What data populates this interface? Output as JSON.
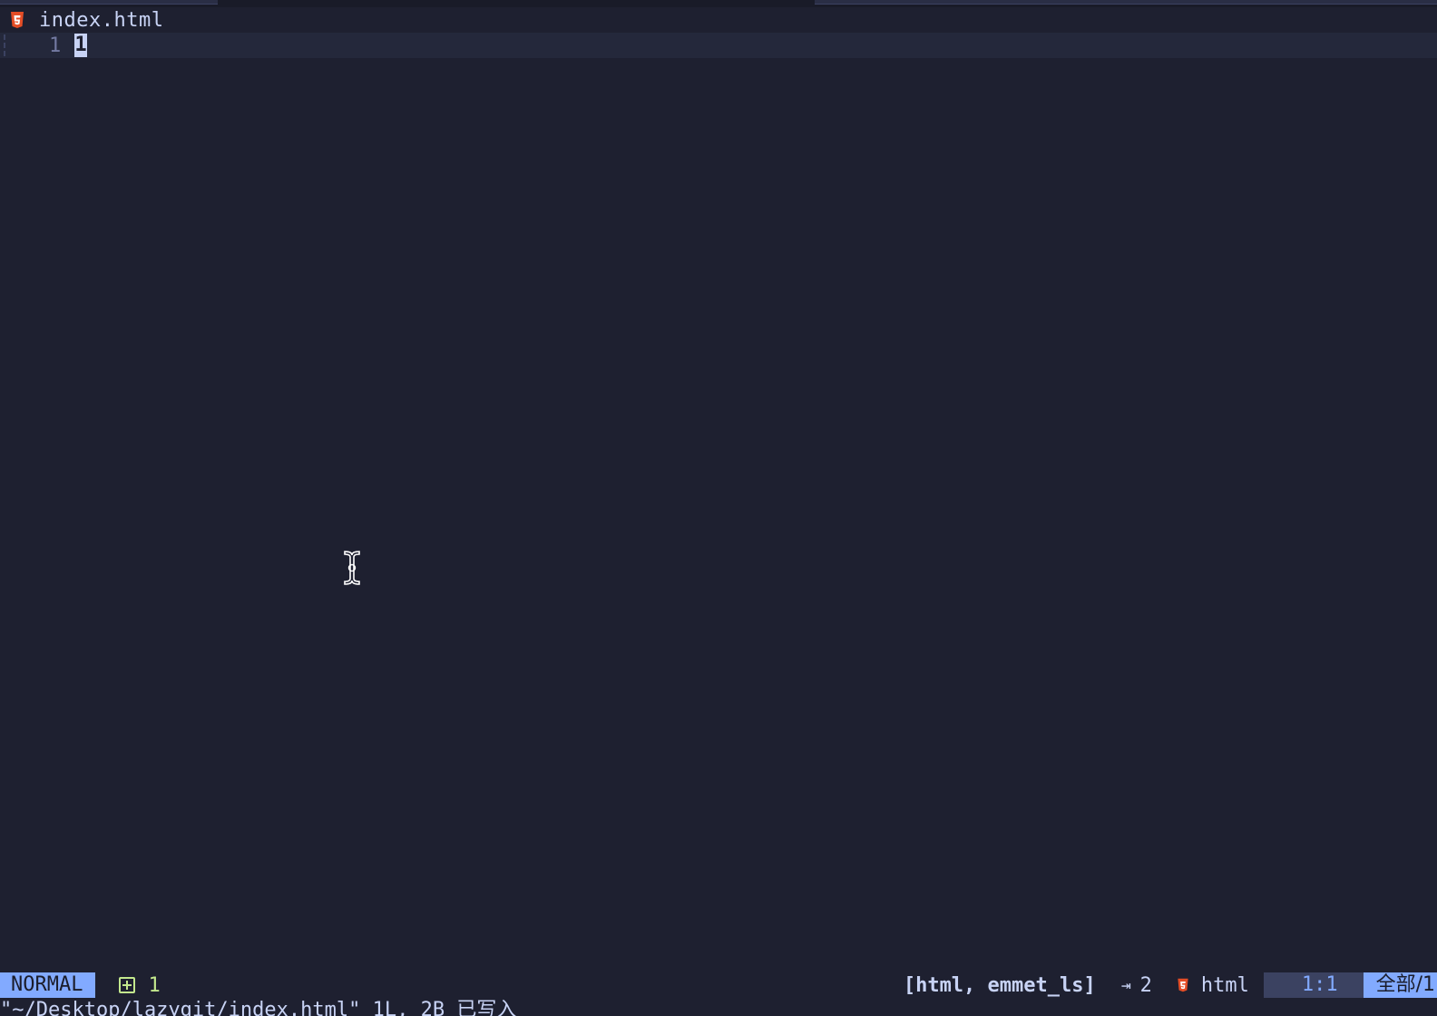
{
  "winbar": {
    "icon": "html5-icon",
    "filename": "index.html"
  },
  "buffer": {
    "lines": [
      {
        "number": "1",
        "text": "1"
      }
    ]
  },
  "statusline": {
    "mode": "NORMAL",
    "git_added_icon": "plus-square-icon",
    "git_added_count": "1",
    "lsp_clients": "[html, emmet_ls]",
    "indent_icon": "tab-arrow-icon",
    "indent_glyph": "⇥",
    "indent_size": "2",
    "filetype_icon": "html5-icon",
    "filetype": "html",
    "position": "1:1",
    "progress": "全部/1"
  },
  "cmdline": {
    "message": "\"~/Desktop/lazygit/index.html\" 1L, 2B 已写入"
  },
  "colors": {
    "background": "#1e2030",
    "cursorline": "#24283b",
    "mode_bg": "#82aaff",
    "git_added": "#c3e88d",
    "html_icon": "#e44d26"
  }
}
